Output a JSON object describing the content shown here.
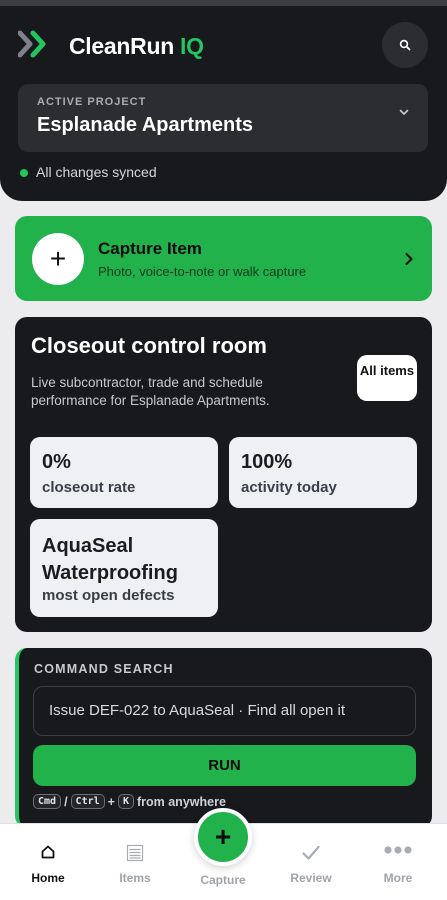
{
  "app": {
    "title_main": "CleanRun",
    "title_accent": "IQ"
  },
  "project": {
    "label": "ACTIVE PROJECT",
    "name": "Esplanade Apartments",
    "sync_status": "All changes synced"
  },
  "capture": {
    "plus": "+",
    "title": "Capture Item",
    "subtitle": "Photo, voice-to-note or walk capture"
  },
  "control_room": {
    "title": "Closeout control room",
    "description": "Live subcontractor, trade and schedule performance for Esplanade Apartments.",
    "all_items_label": "All items",
    "stats": [
      {
        "value": "0%",
        "label": "closeout rate"
      },
      {
        "value": "100%",
        "label": "activity today"
      },
      {
        "value": "AquaSeal Waterproofing",
        "label": "most open defects"
      }
    ]
  },
  "command": {
    "label": "COMMAND SEARCH",
    "suggestions": "Issue DEF-022 to AquaSeal  ·  Find all open it",
    "run_label": "RUN",
    "shortcut_keys": [
      "Cmd",
      "Ctrl",
      "K"
    ],
    "shortcut_sep_slash": "/",
    "shortcut_sep_plus": "+",
    "shortcut_text": "from anywhere"
  },
  "nav": {
    "items": [
      {
        "label": "Home",
        "icon": "home-icon",
        "active": true
      },
      {
        "label": "Items",
        "icon": "list-icon",
        "active": false
      },
      {
        "label": "Review",
        "icon": "check-icon",
        "active": false
      },
      {
        "label": "More",
        "icon": "dots-icon",
        "active": false
      }
    ],
    "capture_label": "Capture",
    "capture_plus": "+"
  },
  "colors": {
    "accent": "#22c55e",
    "accent_dark": "#22b24c",
    "panel": "#17191c",
    "background": "#ececee"
  }
}
